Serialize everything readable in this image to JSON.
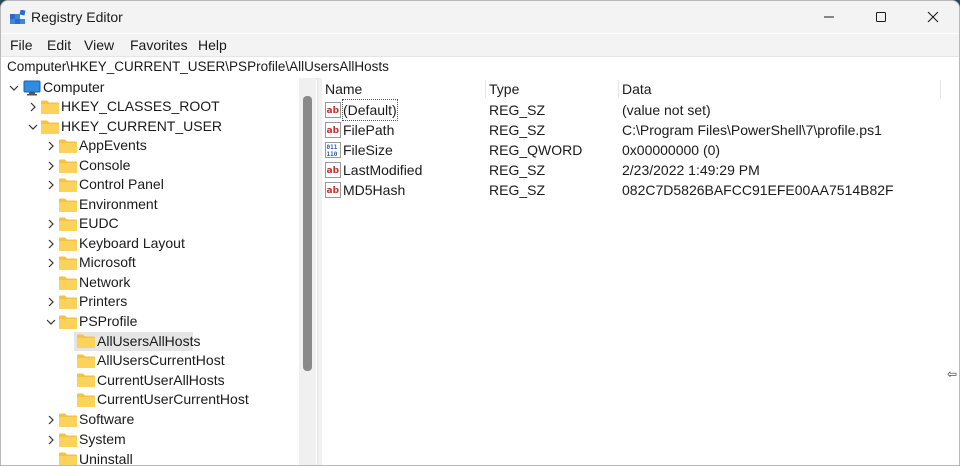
{
  "window": {
    "title": "Registry Editor"
  },
  "menu": {
    "file": "File",
    "edit": "Edit",
    "view": "View",
    "favorites": "Favorites",
    "help": "Help"
  },
  "address": "Computer\\HKEY_CURRENT_USER\\PSProfile\\AllUsersAllHosts",
  "tree": {
    "root": "Computer",
    "hkcr": "HKEY_CLASSES_ROOT",
    "hkcu": "HKEY_CURRENT_USER",
    "appevents": "AppEvents",
    "console": "Console",
    "controlpanel": "Control Panel",
    "environment": "Environment",
    "eudc": "EUDC",
    "keyboardlayout": "Keyboard Layout",
    "microsoft": "Microsoft",
    "network": "Network",
    "printers": "Printers",
    "psprofile": "PSProfile",
    "allusersallhosts": "AllUsersAllHosts",
    "alluserscurrenthost": "AllUsersCurrentHost",
    "currentuserallhosts": "CurrentUserAllHosts",
    "currentusercurrenthost": "CurrentUserCurrentHost",
    "software": "Software",
    "system": "System",
    "uninstall": "Uninstall"
  },
  "columns": {
    "name": "Name",
    "type": "Type",
    "data": "Data"
  },
  "values": [
    {
      "name": "(Default)",
      "type": "REG_SZ",
      "data": "(value not set)",
      "icon": "string-value-icon"
    },
    {
      "name": "FilePath",
      "type": "REG_SZ",
      "data": "C:\\Program Files\\PowerShell\\7\\profile.ps1",
      "icon": "string-value-icon"
    },
    {
      "name": "FileSize",
      "type": "REG_QWORD",
      "data": "0x00000000 (0)",
      "icon": "binary-value-icon"
    },
    {
      "name": "LastModified",
      "type": "REG_SZ",
      "data": "2/23/2022 1:49:29 PM",
      "icon": "string-value-icon"
    },
    {
      "name": "MD5Hash",
      "type": "REG_SZ",
      "data": "082C7D5826BAFCC91EFE00AA7514B82F",
      "icon": "string-value-icon"
    }
  ],
  "colors": {
    "folder": "#f5c343",
    "selection": "#e5e5e5",
    "stringIconRed": "#c4322b",
    "binaryIconBlue": "#2a5db0"
  }
}
